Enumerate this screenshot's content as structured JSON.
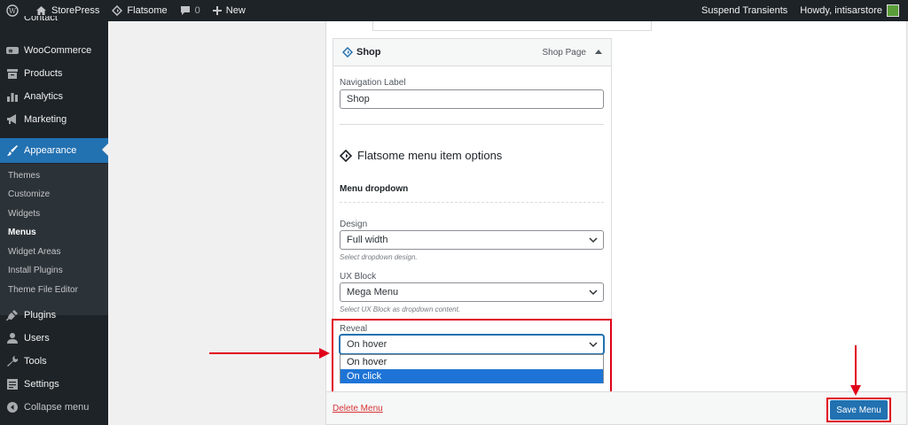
{
  "adminbar": {
    "site_name": "StorePress",
    "theme_name": "Flatsome",
    "comments_count": "0",
    "new_label": "New",
    "suspend_label": "Suspend Transients",
    "howdy_label": "Howdy, intisarstore"
  },
  "sidebar": {
    "contact_label": "Contact",
    "items": [
      {
        "label": "WooCommerce",
        "icon": "woo-icon"
      },
      {
        "label": "Products",
        "icon": "archive-icon"
      },
      {
        "label": "Analytics",
        "icon": "bar-chart-icon"
      },
      {
        "label": "Marketing",
        "icon": "megaphone-icon"
      },
      {
        "label": "Appearance",
        "icon": "brush-icon"
      },
      {
        "label": "Plugins",
        "icon": "plugin-icon"
      },
      {
        "label": "Users",
        "icon": "user-icon"
      },
      {
        "label": "Tools",
        "icon": "wrench-icon"
      },
      {
        "label": "Settings",
        "icon": "settings-icon"
      },
      {
        "label": "Collapse menu",
        "icon": "collapse-icon"
      }
    ],
    "submenu": [
      "Themes",
      "Customize",
      "Widgets",
      "Menus",
      "Widget Areas",
      "Install Plugins",
      "Theme File Editor"
    ]
  },
  "menu_item": {
    "title": "Shop",
    "type": "Shop Page",
    "nav_label_title": "Navigation Label",
    "nav_label_value": "Shop"
  },
  "flatsome": {
    "heading": "Flatsome menu item options",
    "dropdown_heading": "Menu dropdown",
    "design_label": "Design",
    "design_value": "Full width",
    "design_help": "Select dropdown design.",
    "ux_label": "UX Block",
    "ux_value": "Mega Menu",
    "ux_help": "Select UX Block as dropdown content.",
    "reveal_label": "Reveal",
    "reveal_value": "On hover",
    "reveal_options": [
      "On hover",
      "On click"
    ]
  },
  "footer": {
    "delete_label": "Delete Menu",
    "save_label": "Save Menu"
  },
  "colors": {
    "accent": "#2271b1",
    "admin_dark": "#1d2327",
    "highlight": "#e0001b"
  }
}
